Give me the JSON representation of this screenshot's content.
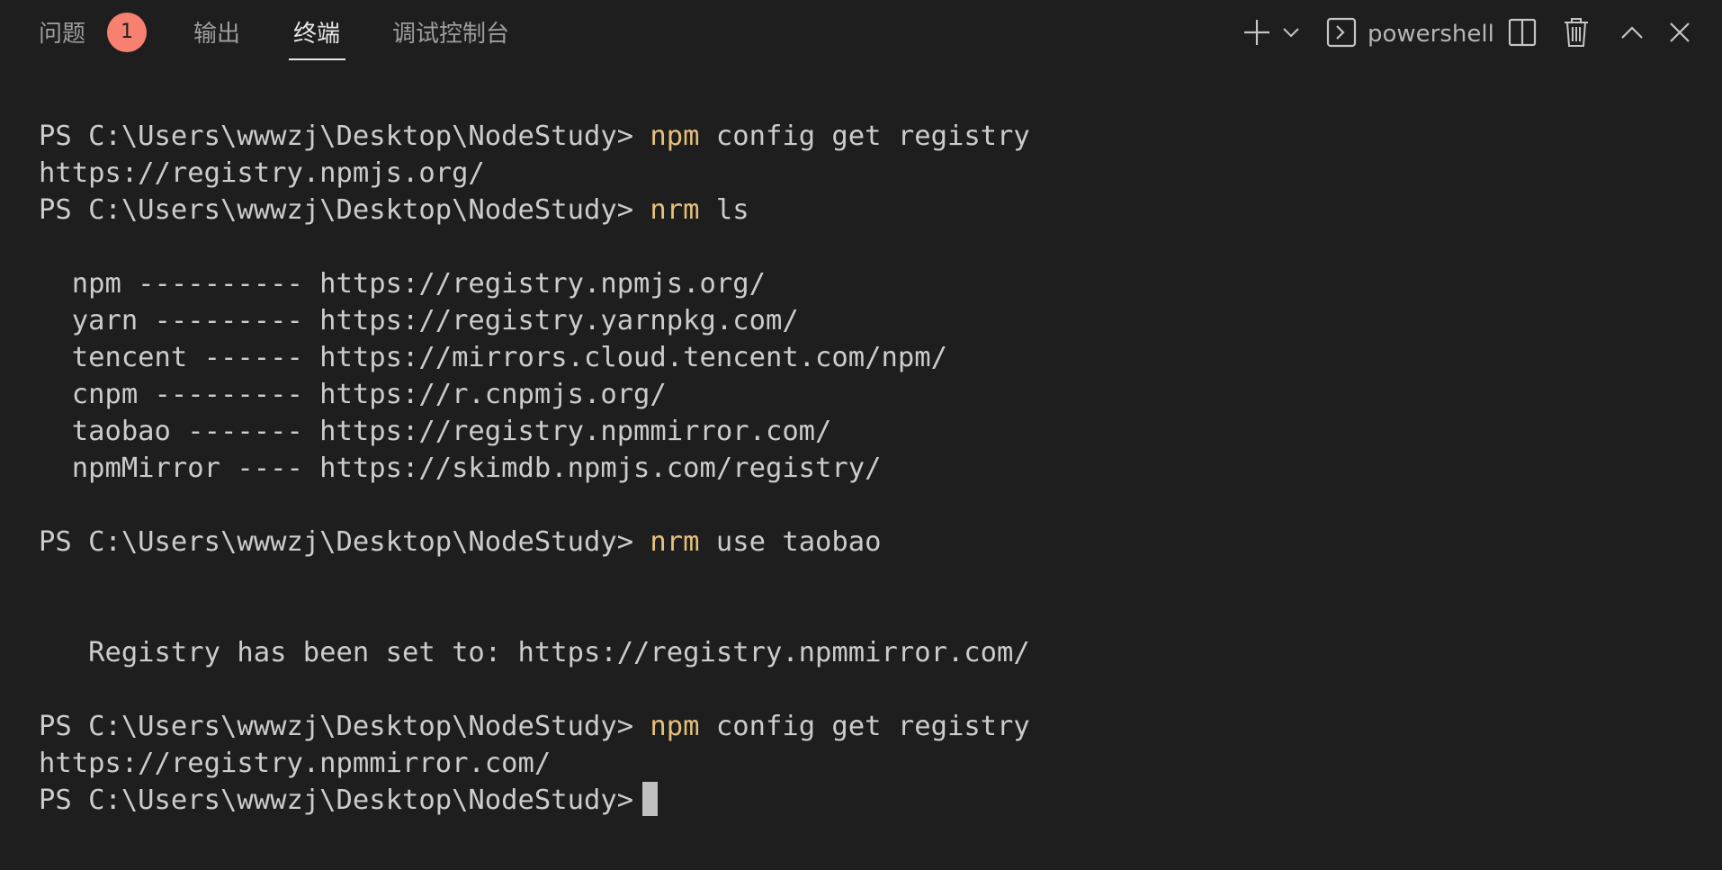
{
  "panel": {
    "tabs": [
      {
        "label": "问题",
        "active": false
      },
      {
        "label": "输出",
        "active": false
      },
      {
        "label": "终端",
        "active": true
      },
      {
        "label": "调试控制台",
        "active": false
      }
    ],
    "problems_badge": "1",
    "shell_name": "powershell",
    "icons": {
      "new_terminal": "plus-icon",
      "new_terminal_dropdown": "chevron-down-icon",
      "shell": "terminal-icon",
      "split": "split-icon",
      "kill": "trash-icon",
      "maximize": "chevron-up-icon",
      "close": "close-icon"
    }
  },
  "terminal": {
    "lines": [
      {
        "prompt": "PS C:\\Users\\wwwzj\\Desktop\\NodeStudy> ",
        "cmd": "npm",
        "args": " config get registry",
        "text": ""
      },
      {
        "prompt": "",
        "cmd": "",
        "args": "",
        "text": "https://registry.npmjs.org/"
      },
      {
        "prompt": "PS C:\\Users\\wwwzj\\Desktop\\NodeStudy> ",
        "cmd": "nrm",
        "args": " ls",
        "text": ""
      },
      {
        "prompt": "",
        "cmd": "",
        "args": "",
        "text": ""
      },
      {
        "prompt": "",
        "cmd": "",
        "args": "",
        "text": "  npm ---------- https://registry.npmjs.org/"
      },
      {
        "prompt": "",
        "cmd": "",
        "args": "",
        "text": "  yarn --------- https://registry.yarnpkg.com/"
      },
      {
        "prompt": "",
        "cmd": "",
        "args": "",
        "text": "  tencent ------ https://mirrors.cloud.tencent.com/npm/"
      },
      {
        "prompt": "",
        "cmd": "",
        "args": "",
        "text": "  cnpm --------- https://r.cnpmjs.org/"
      },
      {
        "prompt": "",
        "cmd": "",
        "args": "",
        "text": "  taobao ------- https://registry.npmmirror.com/"
      },
      {
        "prompt": "",
        "cmd": "",
        "args": "",
        "text": "  npmMirror ---- https://skimdb.npmjs.com/registry/"
      },
      {
        "prompt": "",
        "cmd": "",
        "args": "",
        "text": ""
      },
      {
        "prompt": "PS C:\\Users\\wwwzj\\Desktop\\NodeStudy> ",
        "cmd": "nrm",
        "args": " use taobao",
        "text": ""
      },
      {
        "prompt": "",
        "cmd": "",
        "args": "",
        "text": ""
      },
      {
        "prompt": "",
        "cmd": "",
        "args": "",
        "text": ""
      },
      {
        "prompt": "",
        "cmd": "",
        "args": "",
        "text": "   Registry has been set to: https://registry.npmmirror.com/"
      },
      {
        "prompt": "",
        "cmd": "",
        "args": "",
        "text": ""
      },
      {
        "prompt": "PS C:\\Users\\wwwzj\\Desktop\\NodeStudy> ",
        "cmd": "npm",
        "args": " config get registry",
        "text": ""
      },
      {
        "prompt": "",
        "cmd": "",
        "args": "",
        "text": "https://registry.npmmirror.com/"
      }
    ],
    "current_prompt": "PS C:\\Users\\wwwzj\\Desktop\\NodeStudy>"
  },
  "colors": {
    "background": "#1e1e1e",
    "command": "#e5c07b",
    "text": "#cccccc",
    "badge": "#f88070"
  }
}
